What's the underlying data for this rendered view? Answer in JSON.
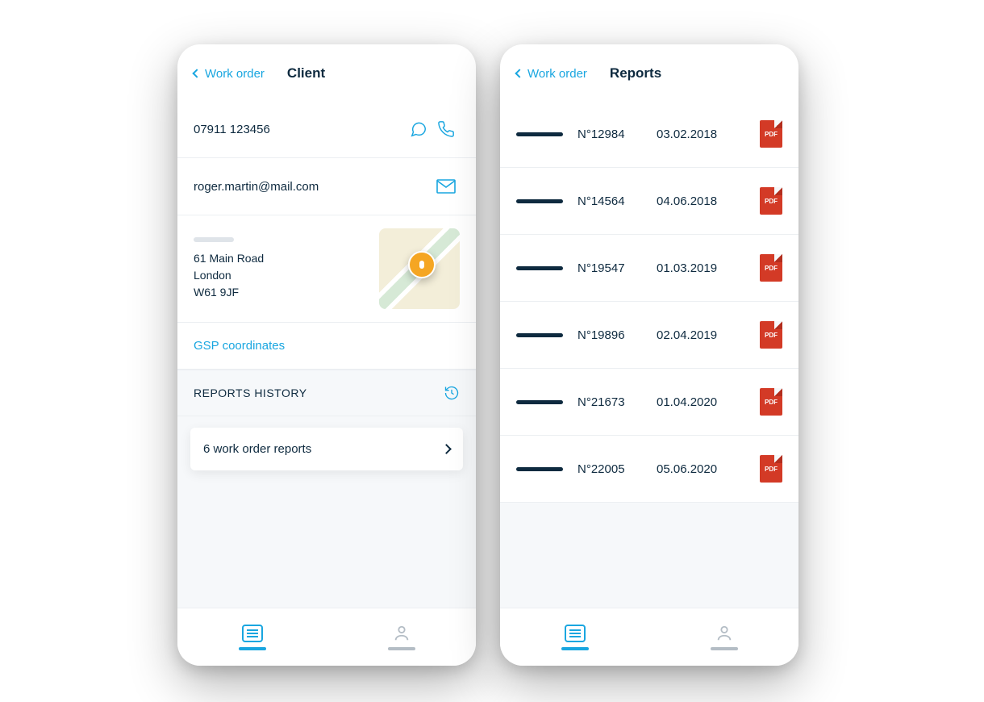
{
  "left": {
    "back_label": "Work order",
    "title": "Client",
    "phone": "07911 123456",
    "email": "roger.martin@mail.com",
    "address": {
      "line1": "61 Main Road",
      "line2": "London",
      "line3": "W61 9JF"
    },
    "gps_link": "GSP coordinates",
    "section_header": "REPORTS HISTORY",
    "reports_card": "6 work order reports"
  },
  "right": {
    "back_label": "Work order",
    "title": "Reports",
    "pdf_label": "PDF",
    "items": [
      {
        "num": "N°12984",
        "date": "03.02.2018"
      },
      {
        "num": "N°14564",
        "date": "04.06.2018"
      },
      {
        "num": "N°19547",
        "date": "01.03.2019"
      },
      {
        "num": "N°19896",
        "date": "02.04.2019"
      },
      {
        "num": "N°21673",
        "date": "01.04.2020"
      },
      {
        "num": "N°22005",
        "date": "05.06.2020"
      }
    ]
  },
  "colors": {
    "accent": "#19a6e0",
    "text": "#0e2a3f",
    "muted": "#b4bdc5",
    "pdf": "#d33a26",
    "pin": "#f5a623"
  }
}
